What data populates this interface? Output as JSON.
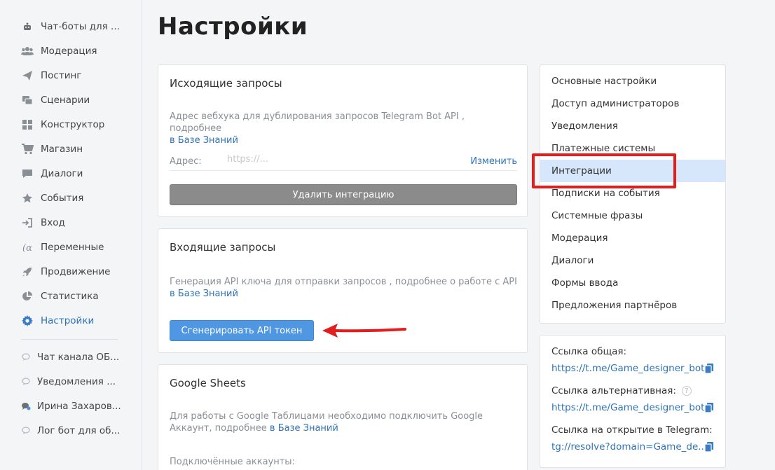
{
  "sidebar": {
    "items": [
      {
        "label": "Чат-боты для ...",
        "icon": "bot-icon"
      },
      {
        "label": "Модерация",
        "icon": "users-icon"
      },
      {
        "label": "Постинг",
        "icon": "send-icon"
      },
      {
        "label": "Сценарии",
        "icon": "scenario-icon"
      },
      {
        "label": "Конструктор",
        "icon": "grid-icon"
      },
      {
        "label": "Магазин",
        "icon": "cart-icon"
      },
      {
        "label": "Диалоги",
        "icon": "chat-icon"
      },
      {
        "label": "События",
        "icon": "star-icon"
      },
      {
        "label": "Вход",
        "icon": "login-icon"
      },
      {
        "label": "Переменные",
        "icon": "variable-icon"
      },
      {
        "label": "Продвижение",
        "icon": "rocket-icon"
      },
      {
        "label": "Статистика",
        "icon": "pie-chart-icon"
      },
      {
        "label": "Настройки",
        "icon": "gear-icon"
      }
    ],
    "channels": [
      {
        "label": "Чат канала ОБ...",
        "icon": "chat-bubble-icon"
      },
      {
        "label": "Уведомления ...",
        "icon": "chat-bubble-icon"
      },
      {
        "label": "Ирина Захаров...",
        "icon": "user-avatar-icon"
      },
      {
        "label": "Лог бот для об...",
        "icon": "chat-bubble-icon"
      }
    ]
  },
  "page": {
    "title": "Настройки"
  },
  "outgoing": {
    "title": "Исходящие запросы",
    "desc": "Адрес вебхука для дублирования запросов Telegram Bot API , подробнее",
    "desc_link": "в Базе Знаний",
    "address_label": "Адрес:",
    "address_placeholder": "https://...",
    "change_label": "Изменить",
    "delete_label": "Удалить интеграцию"
  },
  "incoming": {
    "title": "Входящие запросы",
    "desc": "Генерация API ключа для отправки запросов , подробнее о работе с API",
    "desc_link": "в Базе Знаний",
    "generate_label": "Сгенерировать API токен"
  },
  "sheets": {
    "title": "Google Sheets",
    "desc": "Для работы с Google Таблицами необходимо подключить Google Аккаунт, подробнее",
    "desc_link": "в Базе Знаний",
    "accounts_label": "Подключённые аккаунты:"
  },
  "settings_menu": {
    "items": [
      "Основные настройки",
      "Доступ администраторов",
      "Уведомления",
      "Платежные системы",
      "Интеграции",
      "Подписки на события",
      "Системные фразы",
      "Модерация",
      "Диалоги",
      "Формы ввода",
      "Предложения партнёров"
    ],
    "active": "Интеграции"
  },
  "links": {
    "general_label": "Ссылка общая:",
    "general_url": "https://t.me/Game_designer_bot",
    "alt_label": "Ссылка альтернативная:",
    "alt_url": "https://t.me/Game_designer_bot",
    "tg_label": "Ссылка на открытие в Telegram:",
    "tg_url": "tg://resolve?domain=Game_de..."
  },
  "colors": {
    "accent": "#2f73b5",
    "button_blue": "#4f97e3",
    "highlight_red": "#e11d1d",
    "active_bg": "#d6e6fb"
  }
}
